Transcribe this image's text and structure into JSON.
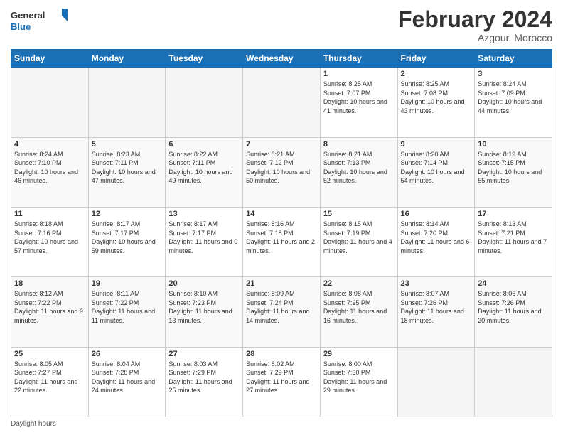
{
  "header": {
    "logo_text_general": "General",
    "logo_text_blue": "Blue",
    "month_title": "February 2024",
    "location": "Azgour, Morocco"
  },
  "days_of_week": [
    "Sunday",
    "Monday",
    "Tuesday",
    "Wednesday",
    "Thursday",
    "Friday",
    "Saturday"
  ],
  "footer": {
    "daylight_label": "Daylight hours"
  },
  "weeks": [
    {
      "days": [
        {
          "num": "",
          "info": ""
        },
        {
          "num": "",
          "info": ""
        },
        {
          "num": "",
          "info": ""
        },
        {
          "num": "",
          "info": ""
        },
        {
          "num": "1",
          "info": "Sunrise: 8:25 AM\nSunset: 7:07 PM\nDaylight: 10 hours\nand 41 minutes."
        },
        {
          "num": "2",
          "info": "Sunrise: 8:25 AM\nSunset: 7:08 PM\nDaylight: 10 hours\nand 43 minutes."
        },
        {
          "num": "3",
          "info": "Sunrise: 8:24 AM\nSunset: 7:09 PM\nDaylight: 10 hours\nand 44 minutes."
        }
      ]
    },
    {
      "days": [
        {
          "num": "4",
          "info": "Sunrise: 8:24 AM\nSunset: 7:10 PM\nDaylight: 10 hours\nand 46 minutes."
        },
        {
          "num": "5",
          "info": "Sunrise: 8:23 AM\nSunset: 7:11 PM\nDaylight: 10 hours\nand 47 minutes."
        },
        {
          "num": "6",
          "info": "Sunrise: 8:22 AM\nSunset: 7:11 PM\nDaylight: 10 hours\nand 49 minutes."
        },
        {
          "num": "7",
          "info": "Sunrise: 8:21 AM\nSunset: 7:12 PM\nDaylight: 10 hours\nand 50 minutes."
        },
        {
          "num": "8",
          "info": "Sunrise: 8:21 AM\nSunset: 7:13 PM\nDaylight: 10 hours\nand 52 minutes."
        },
        {
          "num": "9",
          "info": "Sunrise: 8:20 AM\nSunset: 7:14 PM\nDaylight: 10 hours\nand 54 minutes."
        },
        {
          "num": "10",
          "info": "Sunrise: 8:19 AM\nSunset: 7:15 PM\nDaylight: 10 hours\nand 55 minutes."
        }
      ]
    },
    {
      "days": [
        {
          "num": "11",
          "info": "Sunrise: 8:18 AM\nSunset: 7:16 PM\nDaylight: 10 hours\nand 57 minutes."
        },
        {
          "num": "12",
          "info": "Sunrise: 8:17 AM\nSunset: 7:17 PM\nDaylight: 10 hours\nand 59 minutes."
        },
        {
          "num": "13",
          "info": "Sunrise: 8:17 AM\nSunset: 7:17 PM\nDaylight: 11 hours\nand 0 minutes."
        },
        {
          "num": "14",
          "info": "Sunrise: 8:16 AM\nSunset: 7:18 PM\nDaylight: 11 hours\nand 2 minutes."
        },
        {
          "num": "15",
          "info": "Sunrise: 8:15 AM\nSunset: 7:19 PM\nDaylight: 11 hours\nand 4 minutes."
        },
        {
          "num": "16",
          "info": "Sunrise: 8:14 AM\nSunset: 7:20 PM\nDaylight: 11 hours\nand 6 minutes."
        },
        {
          "num": "17",
          "info": "Sunrise: 8:13 AM\nSunset: 7:21 PM\nDaylight: 11 hours\nand 7 minutes."
        }
      ]
    },
    {
      "days": [
        {
          "num": "18",
          "info": "Sunrise: 8:12 AM\nSunset: 7:22 PM\nDaylight: 11 hours\nand 9 minutes."
        },
        {
          "num": "19",
          "info": "Sunrise: 8:11 AM\nSunset: 7:22 PM\nDaylight: 11 hours\nand 11 minutes."
        },
        {
          "num": "20",
          "info": "Sunrise: 8:10 AM\nSunset: 7:23 PM\nDaylight: 11 hours\nand 13 minutes."
        },
        {
          "num": "21",
          "info": "Sunrise: 8:09 AM\nSunset: 7:24 PM\nDaylight: 11 hours\nand 14 minutes."
        },
        {
          "num": "22",
          "info": "Sunrise: 8:08 AM\nSunset: 7:25 PM\nDaylight: 11 hours\nand 16 minutes."
        },
        {
          "num": "23",
          "info": "Sunrise: 8:07 AM\nSunset: 7:26 PM\nDaylight: 11 hours\nand 18 minutes."
        },
        {
          "num": "24",
          "info": "Sunrise: 8:06 AM\nSunset: 7:26 PM\nDaylight: 11 hours\nand 20 minutes."
        }
      ]
    },
    {
      "days": [
        {
          "num": "25",
          "info": "Sunrise: 8:05 AM\nSunset: 7:27 PM\nDaylight: 11 hours\nand 22 minutes."
        },
        {
          "num": "26",
          "info": "Sunrise: 8:04 AM\nSunset: 7:28 PM\nDaylight: 11 hours\nand 24 minutes."
        },
        {
          "num": "27",
          "info": "Sunrise: 8:03 AM\nSunset: 7:29 PM\nDaylight: 11 hours\nand 25 minutes."
        },
        {
          "num": "28",
          "info": "Sunrise: 8:02 AM\nSunset: 7:29 PM\nDaylight: 11 hours\nand 27 minutes."
        },
        {
          "num": "29",
          "info": "Sunrise: 8:00 AM\nSunset: 7:30 PM\nDaylight: 11 hours\nand 29 minutes."
        },
        {
          "num": "",
          "info": ""
        },
        {
          "num": "",
          "info": ""
        }
      ]
    }
  ]
}
